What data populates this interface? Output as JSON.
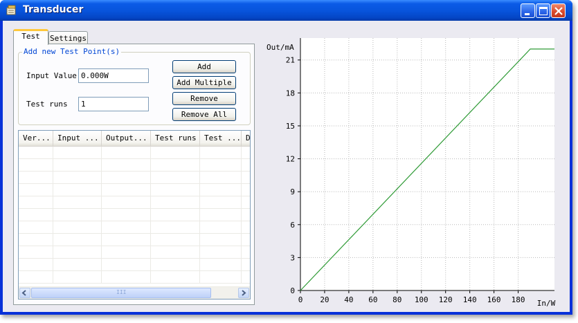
{
  "window": {
    "title": "Transducer",
    "icon": "app-icon",
    "controls": [
      "minimize-icon",
      "maximize-icon",
      "close-icon"
    ]
  },
  "tabs": [
    {
      "label": "Test",
      "active": true
    },
    {
      "label": "Settings",
      "active": false
    }
  ],
  "test_panel": {
    "group_title": "Add new Test Point(s)",
    "input_value_label": "Input Value",
    "input_value": "0.000W",
    "test_runs_label": "Test runs",
    "test_runs_value": "1",
    "buttons": {
      "add": "Add",
      "add_multiple": "Add Multiple",
      "remove": "Remove",
      "remove_all": "Remove All"
    },
    "list_columns": [
      "Ver...",
      "Input ...",
      "Output...",
      "Test runs",
      "Test ...",
      "D"
    ],
    "rows": [],
    "scroll_thumb_glyph": "III"
  },
  "chart_data": {
    "type": "line",
    "xlabel": "In/W",
    "ylabel": "Out/mA",
    "xlim": [
      0,
      210
    ],
    "ylim": [
      0,
      23
    ],
    "x_ticks": [
      0,
      20,
      40,
      60,
      80,
      100,
      120,
      140,
      160,
      180
    ],
    "y_ticks": [
      0,
      3,
      6,
      9,
      12,
      15,
      18,
      21
    ],
    "grid": true,
    "grid_style": "dotted",
    "line_color": "#2e9a35",
    "series": [
      {
        "x": [
          0,
          190,
          210
        ],
        "y": [
          0,
          22,
          22
        ]
      }
    ]
  }
}
